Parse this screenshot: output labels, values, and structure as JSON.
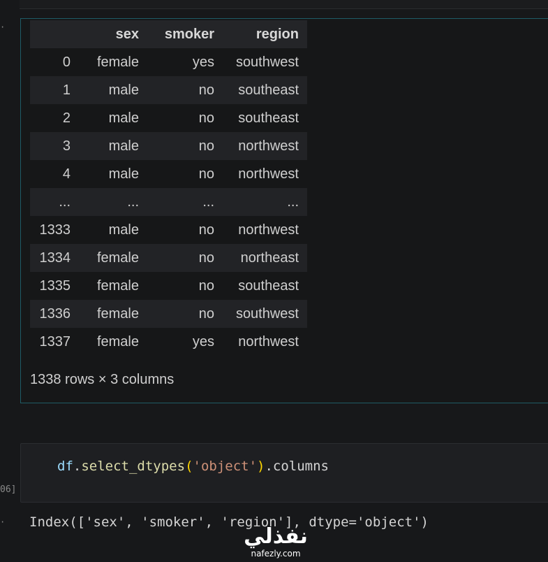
{
  "gutter": {
    "dot_top": "·",
    "dot_bottom": "·",
    "exec_count": "06]"
  },
  "dataframe": {
    "columns": [
      "",
      "sex",
      "smoker",
      "region"
    ],
    "rows": [
      [
        "0",
        "female",
        "yes",
        "southwest"
      ],
      [
        "1",
        "male",
        "no",
        "southeast"
      ],
      [
        "2",
        "male",
        "no",
        "southeast"
      ],
      [
        "3",
        "male",
        "no",
        "northwest"
      ],
      [
        "4",
        "male",
        "no",
        "northwest"
      ],
      [
        "...",
        "...",
        "...",
        "..."
      ],
      [
        "1333",
        "male",
        "no",
        "northwest"
      ],
      [
        "1334",
        "female",
        "no",
        "northeast"
      ],
      [
        "1335",
        "female",
        "no",
        "southeast"
      ],
      [
        "1336",
        "female",
        "no",
        "southwest"
      ],
      [
        "1337",
        "female",
        "yes",
        "northwest"
      ]
    ],
    "shape": "1338 rows × 3 columns"
  },
  "code": {
    "var": "df",
    "dot": ".",
    "fn": "select_dtypes",
    "open": "(",
    "arg": "'object'",
    "close": ")",
    "rest": ".columns"
  },
  "output": {
    "text": "Index(['sex', 'smoker', 'region'], dtype='object')"
  },
  "watermark": {
    "arabic": "نفذلي",
    "latin": "nafezly.com"
  }
}
